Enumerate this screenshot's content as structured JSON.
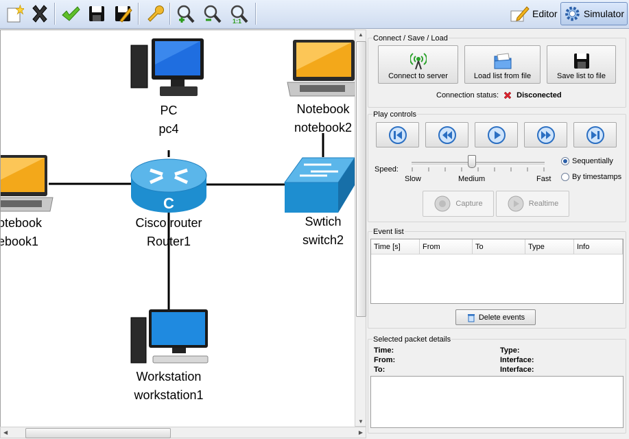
{
  "toolbar": {
    "tools": [
      {
        "name": "new-icon"
      },
      {
        "name": "delete-icon"
      },
      {
        "name": "validate-icon"
      },
      {
        "name": "save-icon"
      },
      {
        "name": "save-as-icon"
      },
      {
        "name": "settings-icon"
      },
      {
        "name": "zoom-in-icon"
      },
      {
        "name": "zoom-out-icon"
      },
      {
        "name": "zoom-reset-icon"
      }
    ],
    "editor_label": "Editor",
    "simulator_label": "Simulator"
  },
  "canvas": {
    "nodes": [
      {
        "type": "PC",
        "name": "pc4"
      },
      {
        "type": "Notebook",
        "name": "notebook2"
      },
      {
        "type": "otebook",
        "name": "ebook1"
      },
      {
        "type": "Cisco router",
        "name": "Router1"
      },
      {
        "type": "Swtich",
        "name": "switch2"
      },
      {
        "type": "Workstation",
        "name": "workstation1"
      }
    ]
  },
  "connect": {
    "title": "Connect / Save / Load",
    "connect_label": "Connect to server",
    "load_label": "Load list from file",
    "save_label": "Save list to file",
    "status_label": "Connection status:",
    "status_value": "Disconected",
    "status_color": "#d9232e"
  },
  "play": {
    "title": "Play controls",
    "speed_label": "Speed:",
    "speed_slow": "Slow",
    "speed_medium": "Medium",
    "speed_fast": "Fast",
    "speed_value": "Medium",
    "mode_sequential": "Sequentially",
    "mode_timestamps": "By timestamps",
    "selected_mode": "Sequentially",
    "capture_label": "Capture",
    "realtime_label": "Realtime"
  },
  "events": {
    "title": "Event list",
    "columns": [
      "Time [s]",
      "From",
      "To",
      "Type",
      "Info"
    ],
    "rows": [],
    "delete_label": "Delete events"
  },
  "details": {
    "title": "Selected packet details",
    "time_label": "Time:",
    "from_label": "From:",
    "to_label": "To:",
    "type_label": "Type:",
    "interface_label_1": "Interface:",
    "interface_label_2": "Interface:"
  },
  "colors": {
    "accent": "#2b6fc2",
    "toolbar": "#cfdcf0"
  }
}
